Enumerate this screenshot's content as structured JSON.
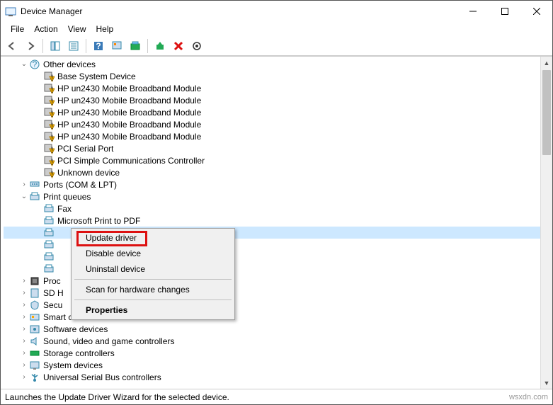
{
  "title": "Device Manager",
  "menus": {
    "file": "File",
    "action": "Action",
    "view": "View",
    "help": "Help"
  },
  "tree": {
    "other_devices": "Other devices",
    "base_system": "Base System Device",
    "hp_bb": "HP un2430 Mobile Broadband Module",
    "pci_serial": "PCI Serial Port",
    "pci_comm": "PCI Simple Communications Controller",
    "unknown": "Unknown device",
    "ports": "Ports (COM & LPT)",
    "print_queues": "Print queues",
    "fax": "Fax",
    "ms_pdf": "Microsoft Print to PDF",
    "proc": "Proc",
    "sdh": "SD H",
    "secu": "Secu",
    "scr": "Smart card readers",
    "swd": "Software devices",
    "svgc": "Sound, video and game controllers",
    "stc": "Storage controllers",
    "sysd": "System devices",
    "usb": "Universal Serial Bus controllers"
  },
  "context": {
    "update": "Update driver",
    "disable": "Disable device",
    "uninstall": "Uninstall device",
    "scan": "Scan for hardware changes",
    "props": "Properties"
  },
  "status": "Launches the Update Driver Wizard for the selected device.",
  "watermark": "wsxdn.com"
}
